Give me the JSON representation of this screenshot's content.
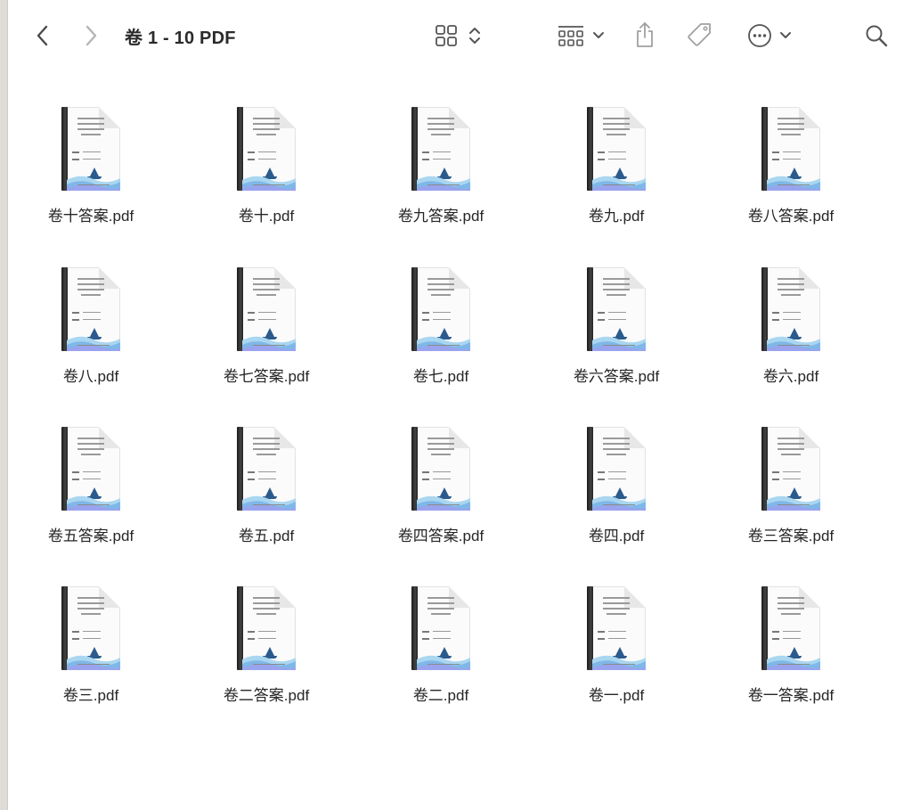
{
  "window": {
    "title": "卷 1 - 10 PDF"
  },
  "toolbar": {
    "back_icon": "chevron-left-icon",
    "forward_icon": "chevron-right-icon",
    "view_icon": "icon-grid-view-icon",
    "group_icon": "group-by-icon",
    "share_icon": "share-icon",
    "tag_icon": "tag-icon",
    "more_icon": "ellipsis-circle-icon",
    "search_icon": "search-icon"
  },
  "files": [
    {
      "name": "卷十答案.pdf"
    },
    {
      "name": "卷十.pdf"
    },
    {
      "name": "卷九答案.pdf"
    },
    {
      "name": "卷九.pdf"
    },
    {
      "name": "卷八答案.pdf"
    },
    {
      "name": "卷八.pdf"
    },
    {
      "name": "卷七答案.pdf"
    },
    {
      "name": "卷七.pdf"
    },
    {
      "name": "卷六答案.pdf"
    },
    {
      "name": "卷六.pdf"
    },
    {
      "name": "卷五答案.pdf"
    },
    {
      "name": "卷五.pdf"
    },
    {
      "name": "卷四答案.pdf"
    },
    {
      "name": "卷四.pdf"
    },
    {
      "name": "卷三答案.pdf"
    },
    {
      "name": "卷三.pdf"
    },
    {
      "name": "卷二答案.pdf"
    },
    {
      "name": "卷二.pdf"
    },
    {
      "name": "卷一.pdf"
    },
    {
      "name": "卷一答案.pdf"
    }
  ]
}
